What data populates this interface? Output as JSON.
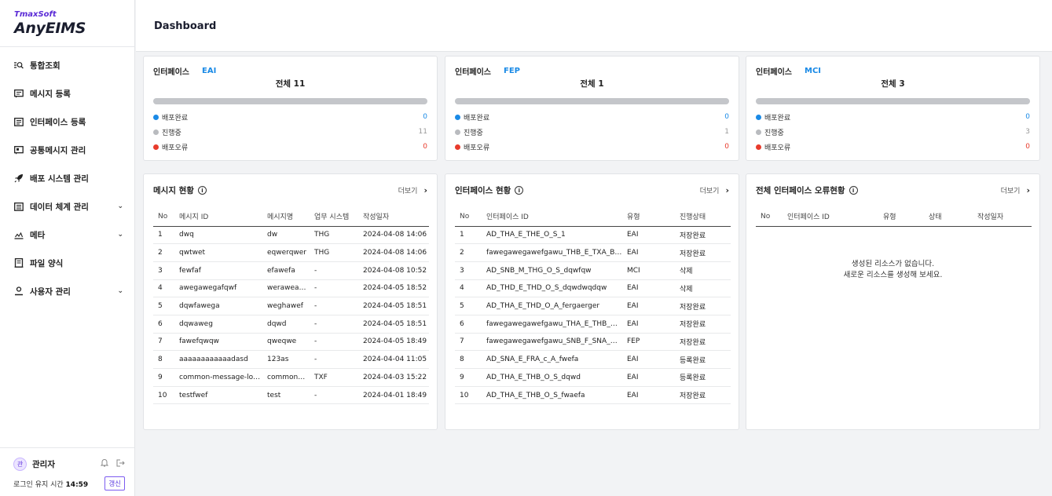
{
  "brand": {
    "company": "TmaxSoft",
    "product": "AnyEIMS"
  },
  "nav": [
    {
      "label": "통합조회",
      "icon": "search-list-icon",
      "expandable": false
    },
    {
      "label": "메시지 등록",
      "icon": "message-icon",
      "expandable": false
    },
    {
      "label": "인터페이스 등록",
      "icon": "interface-icon",
      "expandable": false
    },
    {
      "label": "공통메시지 관리",
      "icon": "common-message-icon",
      "expandable": false
    },
    {
      "label": "배포 시스템 관리",
      "icon": "rocket-icon",
      "expandable": false
    },
    {
      "label": "데이터 체계 관리",
      "icon": "data-icon",
      "expandable": true
    },
    {
      "label": "메타",
      "icon": "meta-icon",
      "expandable": true
    },
    {
      "label": "파일 양식",
      "icon": "file-icon",
      "expandable": false
    },
    {
      "label": "사용자 관리",
      "icon": "user-icon",
      "expandable": true
    }
  ],
  "footer": {
    "avatar_char": "관",
    "user_name": "관리자",
    "session_label": "로그인 유지 시간 ",
    "session_time": "14:59",
    "renew_label": "갱신"
  },
  "page_title": "Dashboard",
  "summary_label": "인터페이스",
  "legend_labels": {
    "deployed": "배포완료",
    "in_progress": "진행중",
    "error": "배포오류"
  },
  "colors": {
    "deployed": "#1a8ae6",
    "in_progress": "#b9bbbf",
    "error": "#e83b2c",
    "accent": "#5b2bd6"
  },
  "summaries": [
    {
      "type": "EAI",
      "total": "전체 11",
      "deployed": "0",
      "in_progress": "11",
      "error": "0",
      "deployed_fraction": 0
    },
    {
      "type": "FEP",
      "total": "전체 1",
      "deployed": "0",
      "in_progress": "1",
      "error": "0",
      "deployed_fraction": 0
    },
    {
      "type": "MCI",
      "total": "전체 3",
      "deployed": "0",
      "in_progress": "3",
      "error": "0",
      "deployed_fraction": 0
    }
  ],
  "more_label": "더보기",
  "messages": {
    "title": "메시지 현황",
    "columns": [
      "No",
      "메시지 ID",
      "메시지명",
      "업무 시스템",
      "작성일자"
    ],
    "rows": [
      [
        "1",
        "dwq",
        "dw",
        "THG",
        "2024-04-08 14:06"
      ],
      [
        "2",
        "qwtwet",
        "eqwerqwer",
        "THG",
        "2024-04-08 14:06"
      ],
      [
        "3",
        "fewfaf",
        "efawefa",
        "-",
        "2024-04-08 10:52"
      ],
      [
        "4",
        "awegawegafqwf",
        "werawea…",
        "-",
        "2024-04-05 18:52"
      ],
      [
        "5",
        "dqwfawega",
        "weghawef",
        "-",
        "2024-04-05 18:51"
      ],
      [
        "6",
        "dqwaweg",
        "dqwd",
        "-",
        "2024-04-05 18:51"
      ],
      [
        "7",
        "fawefqwqw",
        "qweqwe",
        "-",
        "2024-04-05 18:49"
      ],
      [
        "8",
        "aaaaaaaaaaaadasd",
        "123as",
        "-",
        "2024-04-04 11:05"
      ],
      [
        "9",
        "common-message-lo…",
        "common…",
        "TXF",
        "2024-04-03 15:22"
      ],
      [
        "10",
        "testfwef",
        "test",
        "-",
        "2024-04-01 18:49"
      ]
    ]
  },
  "interfaces": {
    "title": "인터페이스 현황",
    "columns": [
      "No",
      "인터페이스 ID",
      "유형",
      "진행상태"
    ],
    "rows": [
      [
        "1",
        "AD_THA_E_THE_O_S_1",
        "EAI",
        "저장완료"
      ],
      [
        "2",
        "fawegawegawefgawu_THB_E_TXA_B_…",
        "EAI",
        "저장완료"
      ],
      [
        "3",
        "AD_SNB_M_THG_O_S_dqwfqw",
        "MCI",
        "삭제"
      ],
      [
        "4",
        "AD_THD_E_THD_O_S_dqwdwqdqw",
        "EAI",
        "삭제"
      ],
      [
        "5",
        "AD_THA_E_THD_O_A_fergaerger",
        "EAI",
        "저장완료"
      ],
      [
        "6",
        "fawegawegawefgawu_THA_E_THB_O_…",
        "EAI",
        "저장완료"
      ],
      [
        "7",
        "fawegawegawefgawu_SNB_F_SNA_O_…",
        "FEP",
        "저장완료"
      ],
      [
        "8",
        "AD_SNA_E_FRA_c_A_fwefa",
        "EAI",
        "등록완료"
      ],
      [
        "9",
        "AD_THA_E_THB_O_S_dqwd",
        "EAI",
        "등록완료"
      ],
      [
        "10",
        "AD_THA_E_THB_O_S_fwaefa",
        "EAI",
        "저장완료"
      ]
    ]
  },
  "errors": {
    "title": "전체 인터페이스 오류현황",
    "columns": [
      "No",
      "인터페이스 ID",
      "유형",
      "상태",
      "작성일자"
    ],
    "empty_line1": "생성된 리소스가 없습니다.",
    "empty_line2": "새로운 리소스를 생성해 보세요."
  }
}
